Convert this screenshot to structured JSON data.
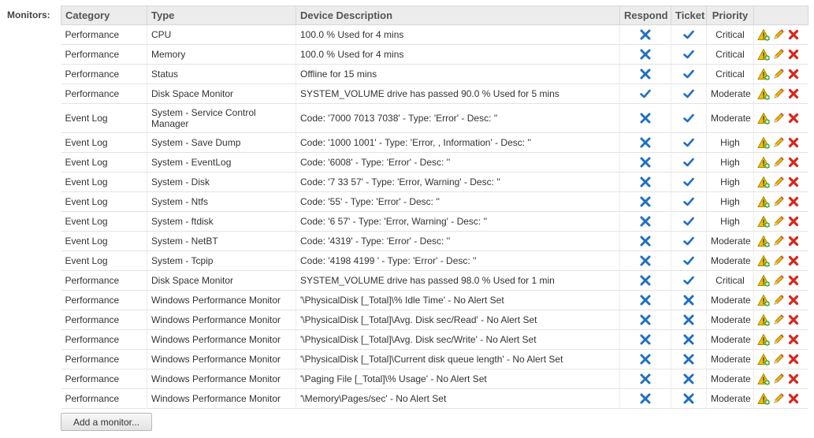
{
  "section_label": "Monitors:",
  "columns": {
    "category": "Category",
    "type": "Type",
    "description": "Device Description",
    "respond": "Respond",
    "ticket": "Ticket",
    "priority": "Priority"
  },
  "rows": [
    {
      "category": "Performance",
      "type": "CPU",
      "description": "100.0 % Used for 4 mins",
      "respond": "x",
      "ticket": "check",
      "priority": "Critical"
    },
    {
      "category": "Performance",
      "type": "Memory",
      "description": "100.0 % Used for 4 mins",
      "respond": "x",
      "ticket": "check",
      "priority": "Critical"
    },
    {
      "category": "Performance",
      "type": "Status",
      "description": "Offline for 15 mins",
      "respond": "x",
      "ticket": "check",
      "priority": "Critical"
    },
    {
      "category": "Performance",
      "type": "Disk Space Monitor",
      "description": "SYSTEM_VOLUME drive has passed 90.0 % Used for 5 mins",
      "respond": "check",
      "ticket": "check",
      "priority": "Moderate"
    },
    {
      "category": "Event Log",
      "type": "System - Service Control Manager",
      "description": "Code: '7000 7013 7038' - Type: 'Error' - Desc: ''",
      "respond": "x",
      "ticket": "check",
      "priority": "Moderate"
    },
    {
      "category": "Event Log",
      "type": "System - Save Dump",
      "description": "Code: '1000 1001' - Type: 'Error, , Information' - Desc: ''",
      "respond": "x",
      "ticket": "check",
      "priority": "High"
    },
    {
      "category": "Event Log",
      "type": "System - EventLog",
      "description": "Code: '6008' - Type: 'Error' - Desc: ''",
      "respond": "x",
      "ticket": "check",
      "priority": "High"
    },
    {
      "category": "Event Log",
      "type": "System - Disk",
      "description": "Code: '7 33 57' - Type: 'Error, Warning' - Desc: ''",
      "respond": "x",
      "ticket": "check",
      "priority": "High"
    },
    {
      "category": "Event Log",
      "type": "System - Ntfs",
      "description": "Code: '55' - Type: 'Error' - Desc: ''",
      "respond": "x",
      "ticket": "check",
      "priority": "High"
    },
    {
      "category": "Event Log",
      "type": "System - ftdisk",
      "description": "Code: '6 57' - Type: 'Error, Warning' - Desc: ''",
      "respond": "x",
      "ticket": "check",
      "priority": "High"
    },
    {
      "category": "Event Log",
      "type": "System - NetBT",
      "description": "Code: '4319' - Type: 'Error' - Desc: ''",
      "respond": "x",
      "ticket": "check",
      "priority": "Moderate"
    },
    {
      "category": "Event Log",
      "type": "System - Tcpip",
      "description": "Code: '4198 4199 ' - Type: 'Error' - Desc: ''",
      "respond": "x",
      "ticket": "check",
      "priority": "Moderate"
    },
    {
      "category": "Performance",
      "type": "Disk Space Monitor",
      "description": "SYSTEM_VOLUME drive has passed 98.0 % Used for 1 min",
      "respond": "x",
      "ticket": "check",
      "priority": "Critical"
    },
    {
      "category": "Performance",
      "type": "Windows Performance Monitor",
      "description": "'\\PhysicalDisk [_Total]\\% Idle Time' - No Alert Set",
      "respond": "x",
      "ticket": "x",
      "priority": "Moderate"
    },
    {
      "category": "Performance",
      "type": "Windows Performance Monitor",
      "description": "'\\PhysicalDisk [_Total]\\Avg. Disk sec/Read' - No Alert Set",
      "respond": "x",
      "ticket": "x",
      "priority": "Moderate"
    },
    {
      "category": "Performance",
      "type": "Windows Performance Monitor",
      "description": "'\\PhysicalDisk [_Total]\\Avg. Disk sec/Write' - No Alert Set",
      "respond": "x",
      "ticket": "x",
      "priority": "Moderate"
    },
    {
      "category": "Performance",
      "type": "Windows Performance Monitor",
      "description": "'\\PhysicalDisk [_Total]\\Current disk queue length' - No Alert Set",
      "respond": "x",
      "ticket": "x",
      "priority": "Moderate"
    },
    {
      "category": "Performance",
      "type": "Windows Performance Monitor",
      "description": "'\\Paging File [_Total]\\% Usage' - No Alert Set",
      "respond": "x",
      "ticket": "x",
      "priority": "Moderate"
    },
    {
      "category": "Performance",
      "type": "Windows Performance Monitor",
      "description": "'\\Memory\\Pages/sec' - No Alert Set",
      "respond": "x",
      "ticket": "x",
      "priority": "Moderate"
    }
  ],
  "row_actions": [
    "alert-add-icon",
    "pencil-edit-icon",
    "delete-x-icon"
  ],
  "add_button_label": "Add a monitor...",
  "colors": {
    "x_blue": "#1f6fc5",
    "check_blue": "#1f6fc5",
    "delete_red": "#d9261c",
    "header_bg": "#ececec"
  }
}
